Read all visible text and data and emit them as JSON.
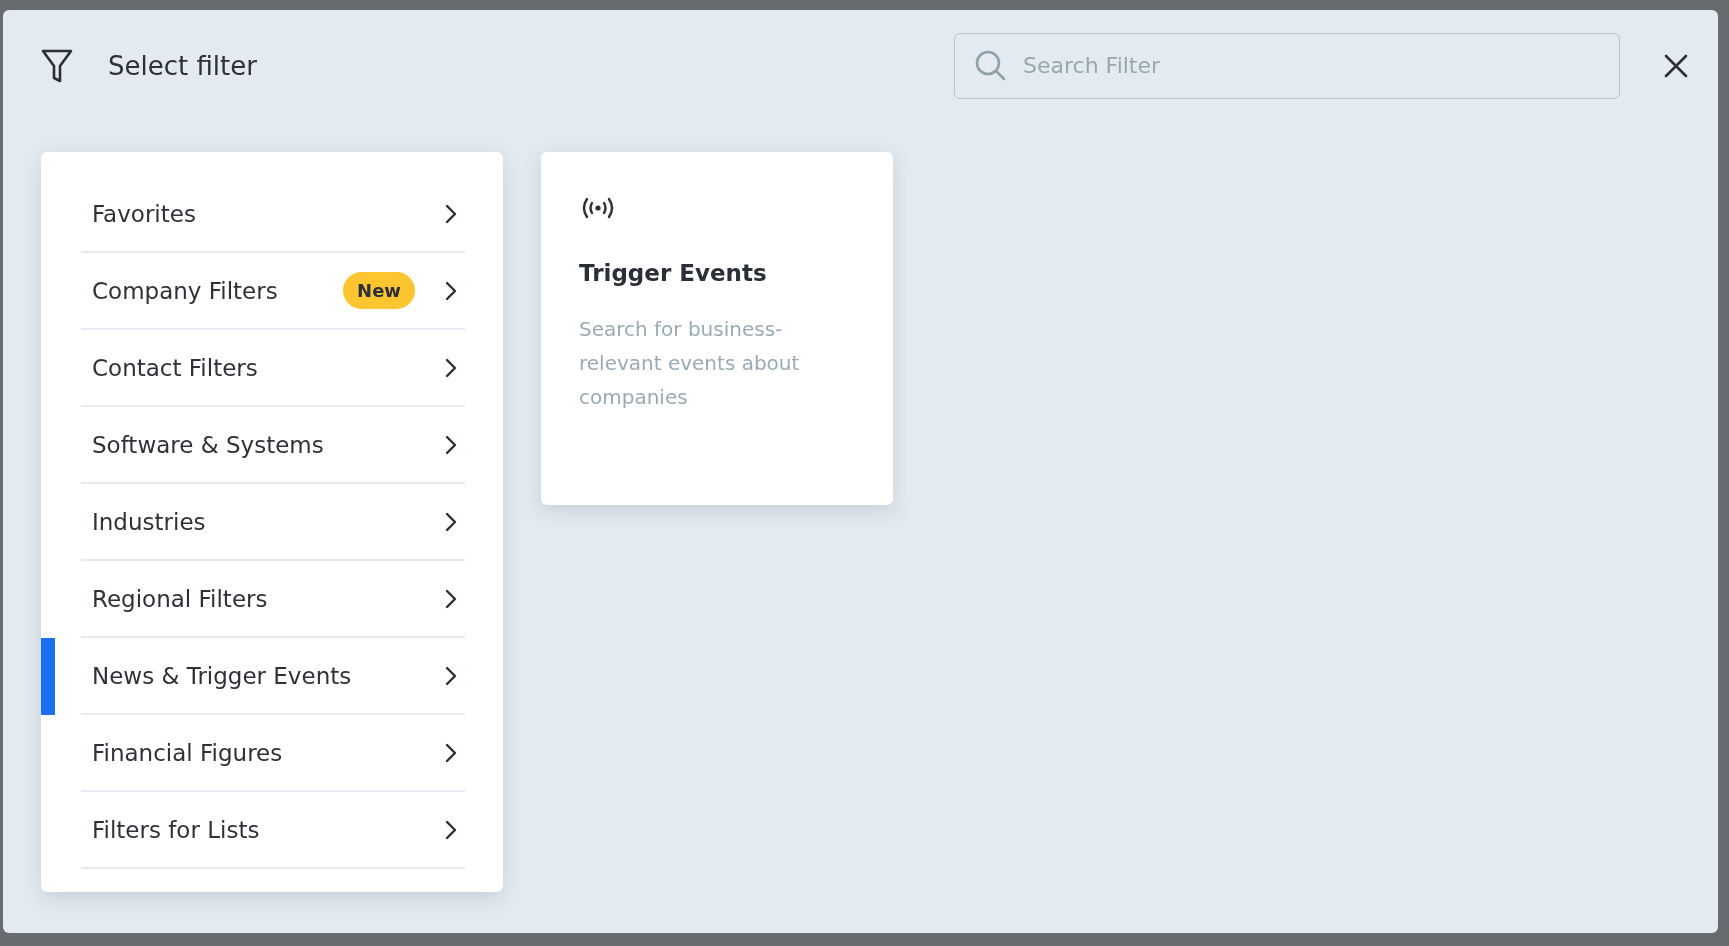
{
  "dialog": {
    "title": "Select filter",
    "search": {
      "placeholder": "Search Filter"
    }
  },
  "categories": [
    {
      "label": "Favorites",
      "selected": false
    },
    {
      "label": "Company Filters",
      "badge": "New",
      "selected": false
    },
    {
      "label": "Contact Filters",
      "selected": false
    },
    {
      "label": "Software & Systems",
      "selected": false
    },
    {
      "label": "Industries",
      "selected": false
    },
    {
      "label": "Regional Filters",
      "selected": false
    },
    {
      "label": "News & Trigger Events",
      "selected": true
    },
    {
      "label": "Financial Figures",
      "selected": false
    },
    {
      "label": "Filters for Lists",
      "selected": false
    }
  ],
  "options": [
    {
      "title": "Trigger Events",
      "description": "Search for business-relevant events about companies"
    }
  ]
}
